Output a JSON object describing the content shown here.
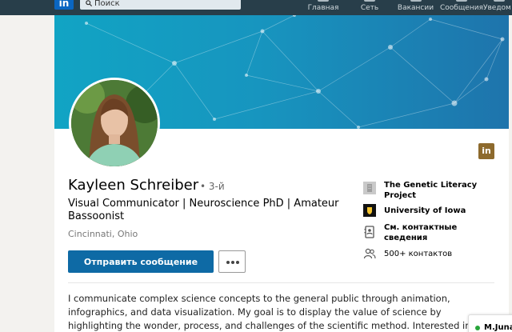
{
  "nav": {
    "logo": "in",
    "search_placeholder": "Поиск",
    "items": [
      {
        "label": "Главная",
        "icon": "home-icon"
      },
      {
        "label": "Сеть",
        "icon": "network-icon"
      },
      {
        "label": "Вакансии",
        "icon": "jobs-icon"
      },
      {
        "label": "Сообщения",
        "icon": "messaging-icon"
      },
      {
        "label": "Уведом",
        "icon": "notifications-icon"
      }
    ]
  },
  "profile": {
    "name": "Kayleen Schreiber",
    "degree": "• 3-й",
    "headline": "Visual Communicator | Neuroscience PhD | Amateur Bassoonist",
    "location": "Cincinnati, Ohio",
    "message_button": "Отправить сообщение",
    "brand_badge": "in",
    "info": [
      {
        "text": "The Genetic Literacy Project",
        "icon": "company-icon"
      },
      {
        "text": "University of Iowa",
        "icon": "university-icon"
      },
      {
        "text": "См. контактные сведения",
        "icon": "contact-card-icon"
      },
      {
        "text": "500+ контактов",
        "icon": "connections-icon"
      }
    ],
    "summary": "I communicate complex science concepts to the general public through animation, infographics, and data visualization. My goal is to display the value of science by highlighting the wonder, process, and challenges of the scientific method. Interested in"
  },
  "chat": {
    "name": "M.Juna"
  },
  "colors": {
    "nav_bg": "#283e4a",
    "primary": "#0e6aa5",
    "banner": "#1795bf",
    "online": "#27a53a"
  }
}
